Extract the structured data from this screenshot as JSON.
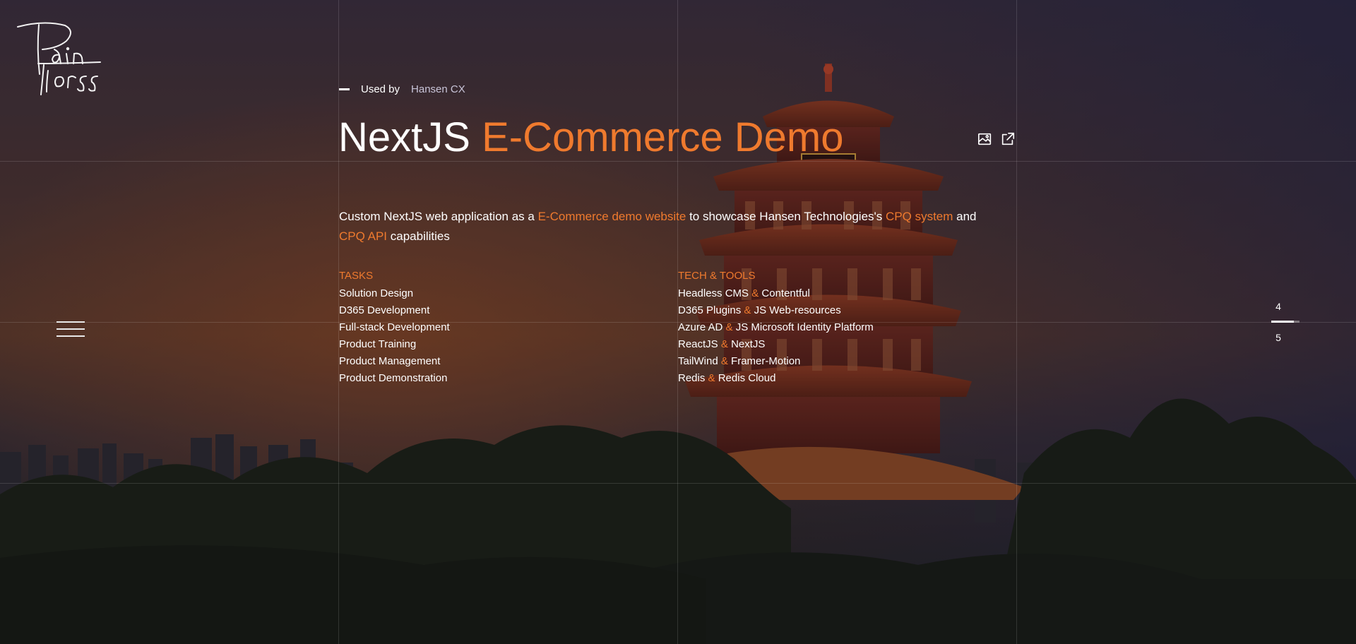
{
  "logo": {
    "icon": "signature-logo",
    "text": "Rain Forss"
  },
  "nav": {
    "menu_icon": "hamburger-icon"
  },
  "project": {
    "used_by_label": "Used by",
    "client": "Hansen CX",
    "title_plain": "NextJS",
    "title_highlight": "E-Commerce Demo",
    "actions": [
      {
        "icon": "gallery-icon"
      },
      {
        "icon": "external-link-icon"
      }
    ],
    "description": {
      "p1": "Custom NextJS web application as a ",
      "h1": "E-Commerce demo website",
      "p2": " to showcase Hansen Technologies's ",
      "h2": "CPQ system",
      "p3": " and ",
      "h3": "CPQ API",
      "p4": " capabilities"
    }
  },
  "tasks": {
    "heading": "TASKS",
    "items": [
      "Solution Design",
      "D365 Development",
      "Full-stack Development",
      "Product Training",
      "Product Management",
      "Product Demonstration"
    ]
  },
  "tech": {
    "heading": "TECH & TOOLS",
    "separator": "&",
    "items": [
      {
        "a": "Headless CMS",
        "b": "Contentful"
      },
      {
        "a": "D365 Plugins",
        "b": "JS Web-resources"
      },
      {
        "a": "Azure AD",
        "b": "JS Microsoft Identity Platform"
      },
      {
        "a": "ReactJS",
        "b": "NextJS"
      },
      {
        "a": "TailWind",
        "b": "Framer-Motion"
      },
      {
        "a": "Redis",
        "b": "Redis Cloud"
      }
    ]
  },
  "pager": {
    "current": "4",
    "next": "5",
    "progress": 0.8
  },
  "colors": {
    "accent": "#ef7a2e",
    "text": "#ffffff",
    "muted": "#c8c4d8"
  }
}
